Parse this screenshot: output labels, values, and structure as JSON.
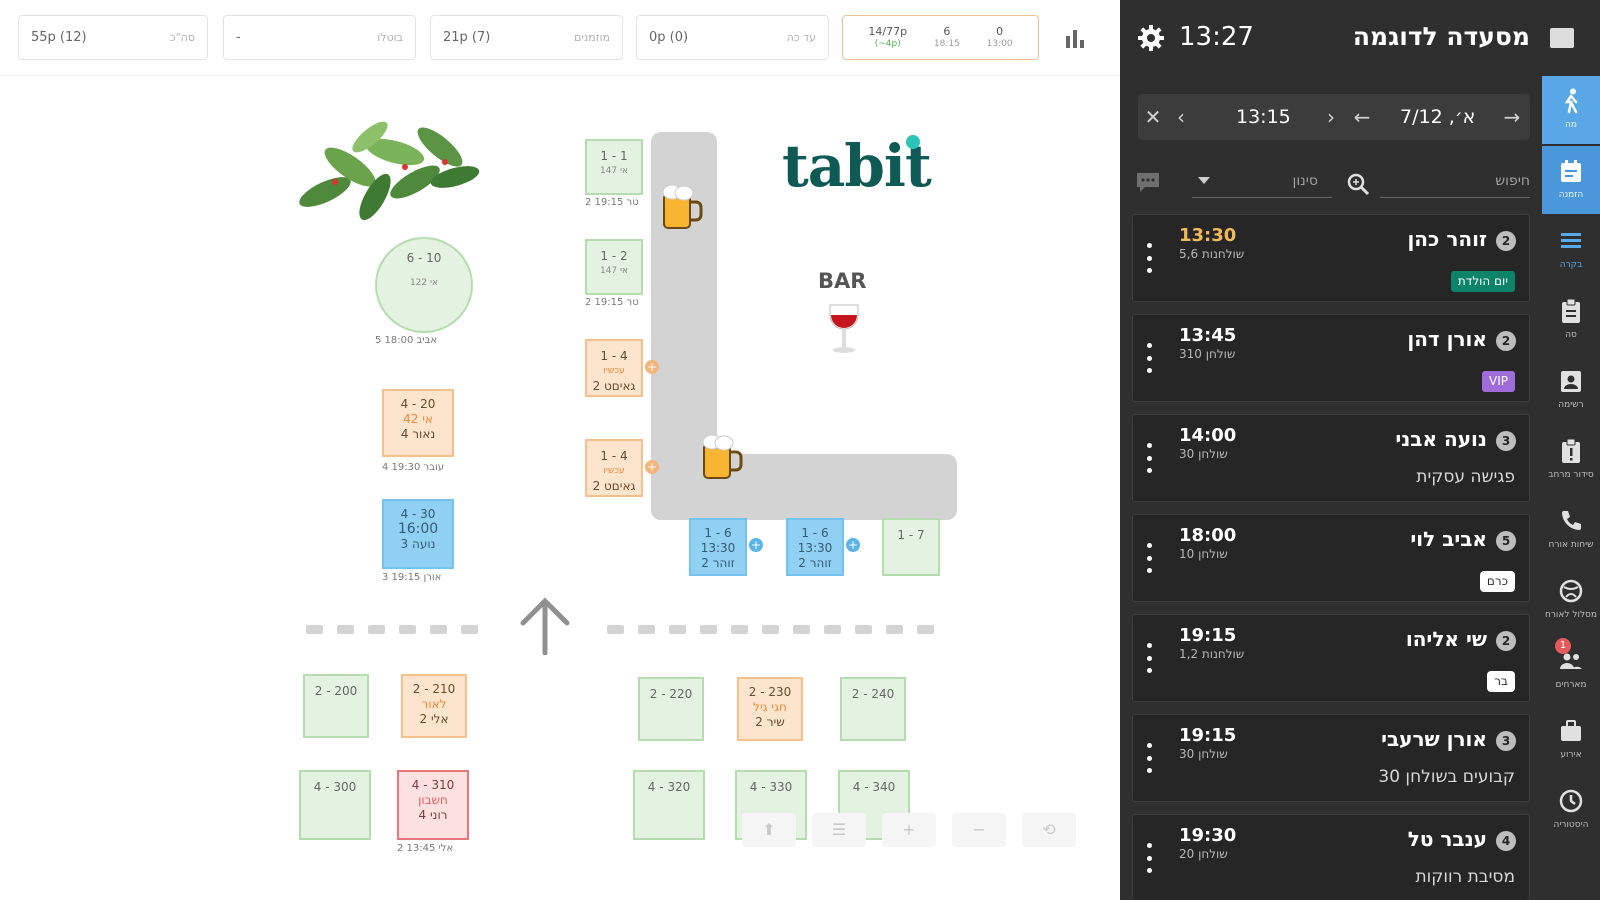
{
  "top_stats": {
    "served": {
      "value": "55p (12)",
      "label": "סה\"כ"
    },
    "cancelled": {
      "value": "-",
      "label": "בוטלו"
    },
    "waiting": {
      "value": "21p (7)",
      "label": "מוזמנים"
    },
    "seated_now": {
      "value": "0p (0)",
      "label": "עד כה"
    },
    "occupancy": [
      {
        "main": "14/77p",
        "sub": "(~4p)"
      },
      {
        "main": "6",
        "sub": "18:15"
      },
      {
        "main": "0",
        "sub": "13:00"
      }
    ]
  },
  "floor": {
    "logo_text": "tabit",
    "bar_label": "BAR",
    "tables": [
      {
        "id": "t1-1",
        "line1": "1 - 1",
        "line2": "147 אי",
        "foot": "2 טר 19:15"
      },
      {
        "id": "t1-2",
        "line1": "1 - 2",
        "line2": "147 אי",
        "foot": "2 טר 19:15"
      },
      {
        "id": "t1-4a",
        "line1": "1 - 4",
        "line2": "עכשיו",
        "line3": "2 גאיםט"
      },
      {
        "id": "t1-4b",
        "line1": "1 - 4",
        "line2": "עכשיו",
        "line3": "2 גאיםט"
      },
      {
        "id": "t6-10",
        "line1": "6 - 10",
        "line2": "122 אי",
        "foot": "5   18:00 אביב"
      },
      {
        "id": "t4-20",
        "line1": "4 - 20",
        "line2": "אי 42",
        "line3": "4 נאור",
        "foot": "4 עובר 19:30"
      },
      {
        "id": "t4-30",
        "line1": "4 - 30",
        "line2": "16:00",
        "line3": "3 נועה",
        "foot": "3 אורן 19:15"
      },
      {
        "id": "t1-6a",
        "line1": "1 - 6",
        "line2": "13:30",
        "line3": "2 זוהר"
      },
      {
        "id": "t1-6b",
        "line1": "1 - 6",
        "line2": "13:30",
        "line3": "2 זוהר"
      },
      {
        "id": "t1-7",
        "line1": "1 - 7"
      },
      {
        "id": "t2-200",
        "line1": "2 - 200"
      },
      {
        "id": "t2-210",
        "line1": "2 - 210",
        "line2": "לאור",
        "line3": "2 אלי"
      },
      {
        "id": "t2-220",
        "line1": "2 - 220"
      },
      {
        "id": "t2-230",
        "line1": "2 - 230",
        "line2": "חגי גיל",
        "line3": "2 שיר"
      },
      {
        "id": "t2-240",
        "line1": "2 - 240"
      },
      {
        "id": "t4-300",
        "line1": "4 - 300"
      },
      {
        "id": "t4-310",
        "line1": "4 - 310",
        "line2": "חשבון",
        "line3": "4 רוני",
        "foot": "2 אלי 13:45"
      },
      {
        "id": "t4-320",
        "line1": "4 - 320"
      },
      {
        "id": "t4-330",
        "line1": "4 - 330"
      },
      {
        "id": "t4-340",
        "line1": "4 - 340"
      }
    ],
    "controls": [
      "⬆",
      "☰",
      "+",
      "−",
      "⟲"
    ]
  },
  "panel": {
    "title": "מסעדה לדוגמה",
    "clock": "13:27",
    "date_nav": {
      "date": "א׳, 7/12",
      "time": "13:15",
      "close": "✕",
      "prev": "‹",
      "next": "›",
      "back_arrow": "←",
      "fwd_arrow": "→"
    },
    "search_placeholder": "חיפוש",
    "filter_label": "סינון",
    "reservations": [
      {
        "covers": "2",
        "name": "זוהר כהן",
        "time": "13:30",
        "table": "שולחנות 5,6",
        "tag": "יום הולדת",
        "tag_style": "green",
        "highlight": true
      },
      {
        "covers": "2",
        "name": "אורן דהן",
        "time": "13:45",
        "table": "שולחן 310",
        "tag": "VIP",
        "tag_style": "purple"
      },
      {
        "covers": "3",
        "name": "נועה אבני",
        "time": "14:00",
        "table": "שולחן 30",
        "note": "פגישה עסקית"
      },
      {
        "covers": "5",
        "name": "אביב לוי",
        "time": "18:00",
        "table": "שולחן 10",
        "tag": "כרם",
        "tag_style": "white"
      },
      {
        "covers": "2",
        "name": "שי אליהו",
        "time": "19:15",
        "table": "שולחנות 1,2",
        "tag": "בר",
        "tag_style": "white"
      },
      {
        "covers": "3",
        "name": "אורן שרעבי",
        "time": "19:15",
        "table": "שולחן 30",
        "note": "קבועים בשולחן 30"
      },
      {
        "covers": "4",
        "name": "ענבר טל",
        "time": "19:30",
        "table": "שולחן 20",
        "note": "מסיבת רווקות"
      }
    ],
    "side_tabs": [
      {
        "label": "מה"
      },
      {
        "label": "הזמנה"
      },
      {
        "label": "בקרה"
      },
      {
        "label": "סה"
      },
      {
        "label": "רשימה"
      },
      {
        "label": "סידור מרחב"
      },
      {
        "label": "שיחות אורח"
      },
      {
        "label": "מסלול לאורח"
      },
      {
        "label": "מארחים"
      },
      {
        "label": "אירוע"
      },
      {
        "label": "היסטוריה"
      }
    ],
    "notification_count": "1"
  }
}
